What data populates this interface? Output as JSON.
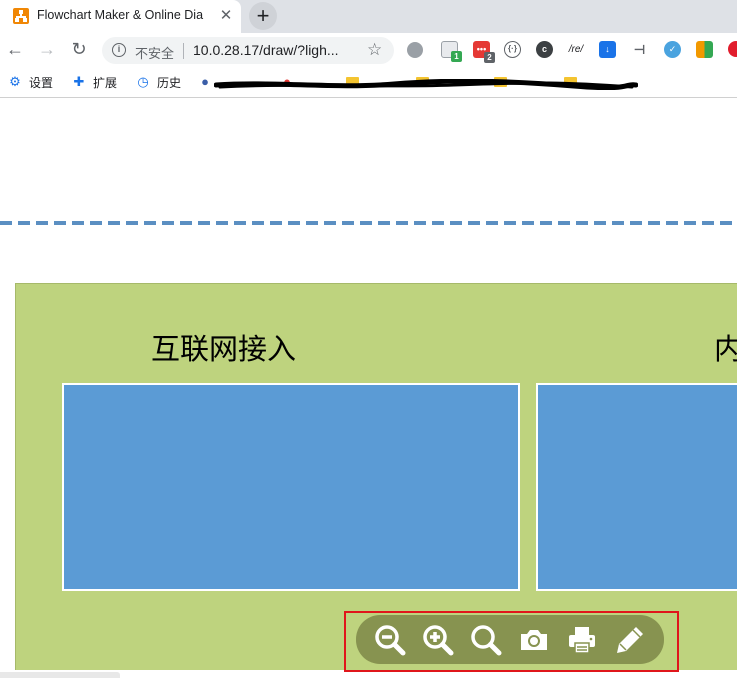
{
  "browser": {
    "tab": {
      "title": "Flowchart Maker & Online Dia",
      "close_glyph": "✕"
    },
    "new_tab_glyph": "+",
    "toolbar": {
      "back_glyph": "←",
      "forward_glyph": "→",
      "reload_glyph": "↻",
      "security_label": "不安全",
      "url": "10.0.28.17/draw/?ligh...",
      "star_glyph": "☆",
      "extensions": [
        {
          "icon": "grey-circle-extension-icon",
          "badge": "",
          "color": "#9aa0a6"
        },
        {
          "icon": "tab-manager-extension-icon",
          "badge": "1",
          "color": "#34a853"
        },
        {
          "icon": "red-dots-extension-icon",
          "badge": "2",
          "color": "#e53935"
        },
        {
          "icon": "code-braces-extension-icon",
          "badge": "",
          "color": "#5f6368"
        },
        {
          "icon": "cookie-extension-icon",
          "badge": "",
          "color": "#3c4043"
        },
        {
          "icon": "regex-extension-icon",
          "badge": "",
          "color": "#5f6368",
          "label": "/re/"
        },
        {
          "icon": "download-extension-icon",
          "badge": "",
          "color": "#1a73e8"
        },
        {
          "icon": "pin-extension-icon",
          "badge": "",
          "color": "#5f6368"
        },
        {
          "icon": "check-badge-extension-icon",
          "badge": "",
          "color": "#4aa3df"
        },
        {
          "icon": "grid-extension-icon",
          "badge": "",
          "color": "#f29900"
        },
        {
          "icon": "opera-extension-icon",
          "badge": "",
          "color": "#e11d2d"
        }
      ]
    },
    "bookmarks": [
      {
        "icon": "gear-icon",
        "label": "设置"
      },
      {
        "icon": "puzzle-icon",
        "label": "扩展"
      },
      {
        "icon": "history-icon",
        "label": "历史"
      }
    ]
  },
  "diagram": {
    "group_left_title": "互联网接入",
    "group_right_title": "内",
    "colors": {
      "group_fill": "#bed37e",
      "box_fill": "#5b9bd5",
      "dashed_line": "#5b8fc2"
    }
  },
  "lightbox_toolbar": {
    "buttons": [
      {
        "name": "zoom-out-button",
        "icon": "zoom-out-icon"
      },
      {
        "name": "zoom-in-button",
        "icon": "zoom-in-icon"
      },
      {
        "name": "fit-button",
        "icon": "magnifier-icon"
      },
      {
        "name": "export-image-button",
        "icon": "camera-icon"
      },
      {
        "name": "print-button",
        "icon": "printer-icon"
      },
      {
        "name": "edit-button",
        "icon": "pencil-icon"
      }
    ],
    "highlight_color": "#e0161b"
  }
}
